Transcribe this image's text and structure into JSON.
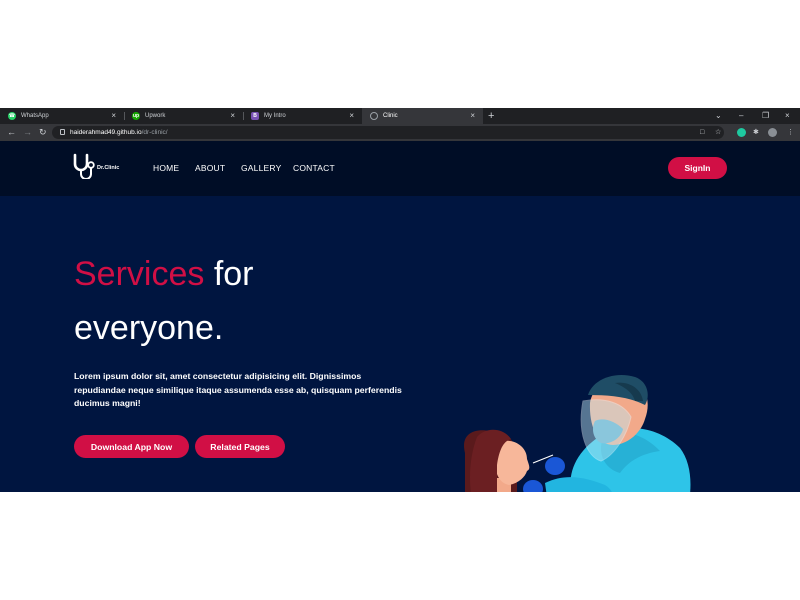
{
  "browser": {
    "tabs": [
      {
        "label": "WhatsApp",
        "favicon": "whatsapp-icon",
        "color": "#25d366"
      },
      {
        "label": "Upwork",
        "favicon": "upwork-icon",
        "color": "#14a800"
      },
      {
        "label": "My Intro",
        "favicon": "bootstrap-icon",
        "color": "#7952b3"
      },
      {
        "label": "Clinic",
        "favicon": "globe-icon",
        "color": "#9aa0a6",
        "active": true
      }
    ],
    "url_host": "haiderahmad49.github.io",
    "url_path": "/dr-clinic/"
  },
  "site": {
    "logo_text": "Dr.Clinic",
    "nav": [
      "HOME",
      "ABOUT",
      "GALLERY",
      "CONTACT"
    ],
    "signin_label": "SignIn"
  },
  "hero": {
    "title_accent": "Services",
    "title_rest": "for",
    "title_line2": "everyone.",
    "description": "Lorem ipsum dolor sit, amet consectetur adipisicing elit. Dignissimos repudiandae neque similique itaque assumenda esse ab, quisquam perferendis ducimus magni!",
    "buttons": [
      "Download App Now",
      "Related Pages"
    ]
  },
  "colors": {
    "accent": "#d10f45",
    "hero_bg": "#001540",
    "header_bg": "#000d26"
  }
}
